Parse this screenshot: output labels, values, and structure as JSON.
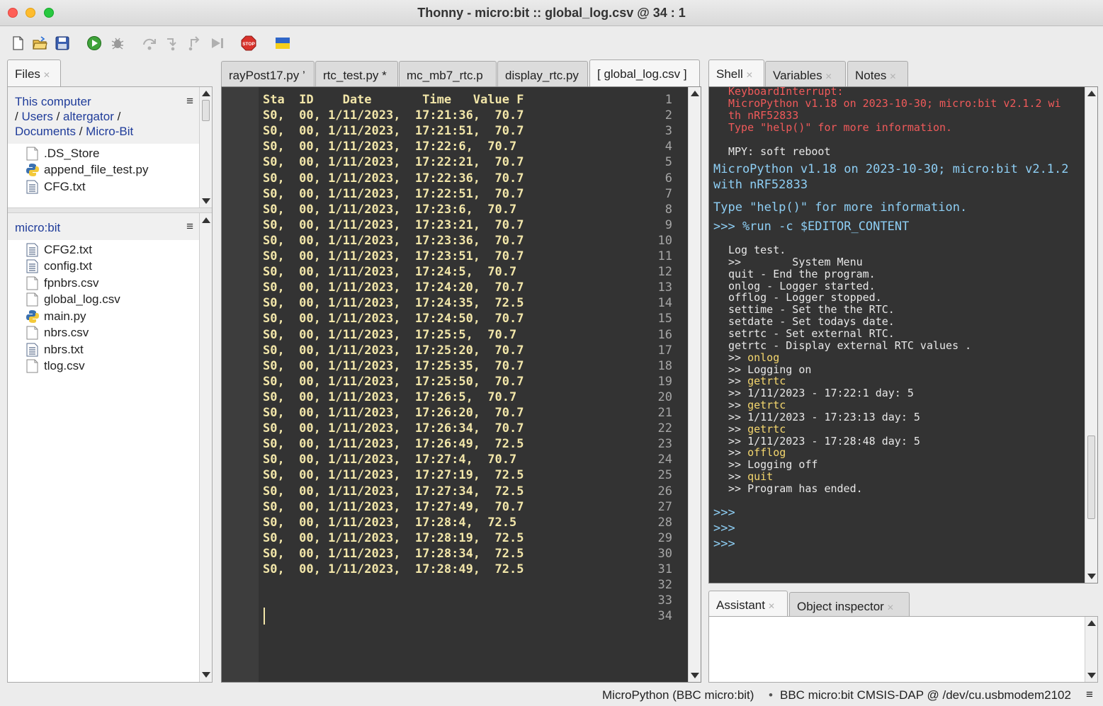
{
  "window": {
    "title": "Thonny  -  micro:bit :: global_log.csv  @  34 : 1"
  },
  "toolbar": {
    "buttons": [
      "new-file",
      "open-file",
      "save-file",
      "run",
      "debug",
      "step-over",
      "step-into",
      "step-out",
      "resume",
      "stop",
      "ukraine-flag"
    ]
  },
  "files": {
    "tab_label": "Files",
    "computer": {
      "root": "This computer",
      "path": [
        "Users",
        "altergator",
        "Documents",
        "Micro-Bit"
      ],
      "items": [
        {
          "name": ".DS_Store",
          "icon": "blank-file-icon"
        },
        {
          "name": "append_file_test.py",
          "icon": "python-file-icon"
        },
        {
          "name": "CFG.txt",
          "icon": "text-file-icon"
        }
      ]
    },
    "device": {
      "title": "micro:bit",
      "items": [
        {
          "name": "CFG2.txt",
          "icon": "text-file-icon"
        },
        {
          "name": "config.txt",
          "icon": "text-file-icon"
        },
        {
          "name": "fpnbrs.csv",
          "icon": "blank-file-icon"
        },
        {
          "name": "global_log.csv",
          "icon": "blank-file-icon"
        },
        {
          "name": "main.py",
          "icon": "python-file-icon"
        },
        {
          "name": "nbrs.csv",
          "icon": "blank-file-icon"
        },
        {
          "name": "nbrs.txt",
          "icon": "text-file-icon"
        },
        {
          "name": "tlog.csv",
          "icon": "blank-file-icon"
        }
      ]
    }
  },
  "editor": {
    "tabs": [
      {
        "label": "rayPost17.py ’",
        "active": false
      },
      {
        "label": "rtc_test.py *",
        "active": false
      },
      {
        "label": "mc_mb7_rtc.p",
        "active": false
      },
      {
        "label": "display_rtc.py",
        "active": false
      },
      {
        "label": "[ global_log.csv ]",
        "active": true
      }
    ],
    "lines": [
      "Sta  ID    Date       Time   Value F",
      "S0,  00, 1/11/2023,  17:21:36,  70.7",
      "S0,  00, 1/11/2023,  17:21:51,  70.7",
      "S0,  00, 1/11/2023,  17:22:6,  70.7",
      "S0,  00, 1/11/2023,  17:22:21,  70.7",
      "S0,  00, 1/11/2023,  17:22:36,  70.7",
      "S0,  00, 1/11/2023,  17:22:51,  70.7",
      "S0,  00, 1/11/2023,  17:23:6,  70.7",
      "S0,  00, 1/11/2023,  17:23:21,  70.7",
      "S0,  00, 1/11/2023,  17:23:36,  70.7",
      "S0,  00, 1/11/2023,  17:23:51,  70.7",
      "S0,  00, 1/11/2023,  17:24:5,  70.7",
      "S0,  00, 1/11/2023,  17:24:20,  70.7",
      "S0,  00, 1/11/2023,  17:24:35,  72.5",
      "S0,  00, 1/11/2023,  17:24:50,  70.7",
      "S0,  00, 1/11/2023,  17:25:5,  70.7",
      "S0,  00, 1/11/2023,  17:25:20,  70.7",
      "S0,  00, 1/11/2023,  17:25:35,  70.7",
      "S0,  00, 1/11/2023,  17:25:50,  70.7",
      "S0,  00, 1/11/2023,  17:26:5,  70.7",
      "S0,  00, 1/11/2023,  17:26:20,  70.7",
      "S0,  00, 1/11/2023,  17:26:34,  70.7",
      "S0,  00, 1/11/2023,  17:26:49,  72.5",
      "S0,  00, 1/11/2023,  17:27:4,  70.7",
      "S0,  00, 1/11/2023,  17:27:19,  72.5",
      "S0,  00, 1/11/2023,  17:27:34,  72.5",
      "S0,  00, 1/11/2023,  17:27:49,  70.7",
      "S0,  00, 1/11/2023,  17:28:4,  72.5",
      "S0,  00, 1/11/2023,  17:28:19,  72.5",
      "S0,  00, 1/11/2023,  17:28:34,  72.5",
      "S0,  00, 1/11/2023,  17:28:49,  72.5",
      "",
      "",
      ""
    ]
  },
  "shell": {
    "tabs": [
      {
        "label": "Shell",
        "active": true
      },
      {
        "label": "Variables",
        "active": false
      },
      {
        "label": "Notes",
        "active": false
      }
    ],
    "header_red": [
      "KeyboardInterrupt:",
      "MicroPython v1.18 on 2023-10-30; micro:bit v2.1.2 wi",
      "th nRF52833",
      "Type \"help()\" for more information."
    ],
    "soft_reboot": "MPY: soft reboot",
    "banner": [
      "MicroPython v1.18 on 2023-10-30; micro:bit v2.1.2",
      "with nRF52833"
    ],
    "help_line": "Type \"help()\" for more information.",
    "command": ">>> %run -c $EDITOR_CONTENT",
    "output": [
      {
        "pre": "Log test.",
        "cmd": "",
        "post": ""
      },
      {
        "pre": ">>        System Menu",
        "cmd": "",
        "post": ""
      },
      {
        "pre": "quit - End the program.",
        "cmd": "",
        "post": ""
      },
      {
        "pre": "onlog - Logger started.",
        "cmd": "",
        "post": ""
      },
      {
        "pre": "offlog - Logger stopped.",
        "cmd": "",
        "post": ""
      },
      {
        "pre": "settime - Set the the RTC.",
        "cmd": "",
        "post": ""
      },
      {
        "pre": "setdate - Set todays date.",
        "cmd": "",
        "post": ""
      },
      {
        "pre": "setrtc - Set external RTC.",
        "cmd": "",
        "post": ""
      },
      {
        "pre": "getrtc - Display external RTC values .",
        "cmd": "",
        "post": ""
      },
      {
        "pre": ">> ",
        "cmd": "onlog",
        "post": ""
      },
      {
        "pre": ">> Logging on",
        "cmd": "",
        "post": ""
      },
      {
        "pre": ">> ",
        "cmd": "getrtc",
        "post": ""
      },
      {
        "pre": ">> 1/11/2023 - 17:22:1 day: 5",
        "cmd": "",
        "post": ""
      },
      {
        "pre": ">> ",
        "cmd": "getrtc",
        "post": ""
      },
      {
        "pre": ">> 1/11/2023 - 17:23:13 day: 5",
        "cmd": "",
        "post": ""
      },
      {
        "pre": ">> ",
        "cmd": "getrtc",
        "post": ""
      },
      {
        "pre": ">> 1/11/2023 - 17:28:48 day: 5",
        "cmd": "",
        "post": ""
      },
      {
        "pre": ">> ",
        "cmd": "offlog",
        "post": ""
      },
      {
        "pre": ">> Logging off",
        "cmd": "",
        "post": ""
      },
      {
        "pre": ">> ",
        "cmd": "quit",
        "post": ""
      },
      {
        "pre": ">> Program has ended.",
        "cmd": "",
        "post": ""
      }
    ],
    "prompts": [
      ">>>",
      ">>>",
      ">>>"
    ]
  },
  "assistant": {
    "tabs": [
      {
        "label": "Assistant",
        "active": true
      },
      {
        "label": "Object inspector",
        "active": false
      }
    ]
  },
  "statusbar": {
    "interpreter": "MicroPython (BBC micro:bit)",
    "separator": "•",
    "port": "BBC micro:bit CMSIS-DAP @ /dev/cu.usbmodem2102"
  },
  "colors": {
    "editor_bg": "#333333",
    "code_text": "#f2e6a9",
    "shell_blue": "#8ecff5",
    "shell_red": "#f05a5a",
    "shell_yellow": "#f5d76e",
    "link_blue": "#1f3c9a"
  }
}
